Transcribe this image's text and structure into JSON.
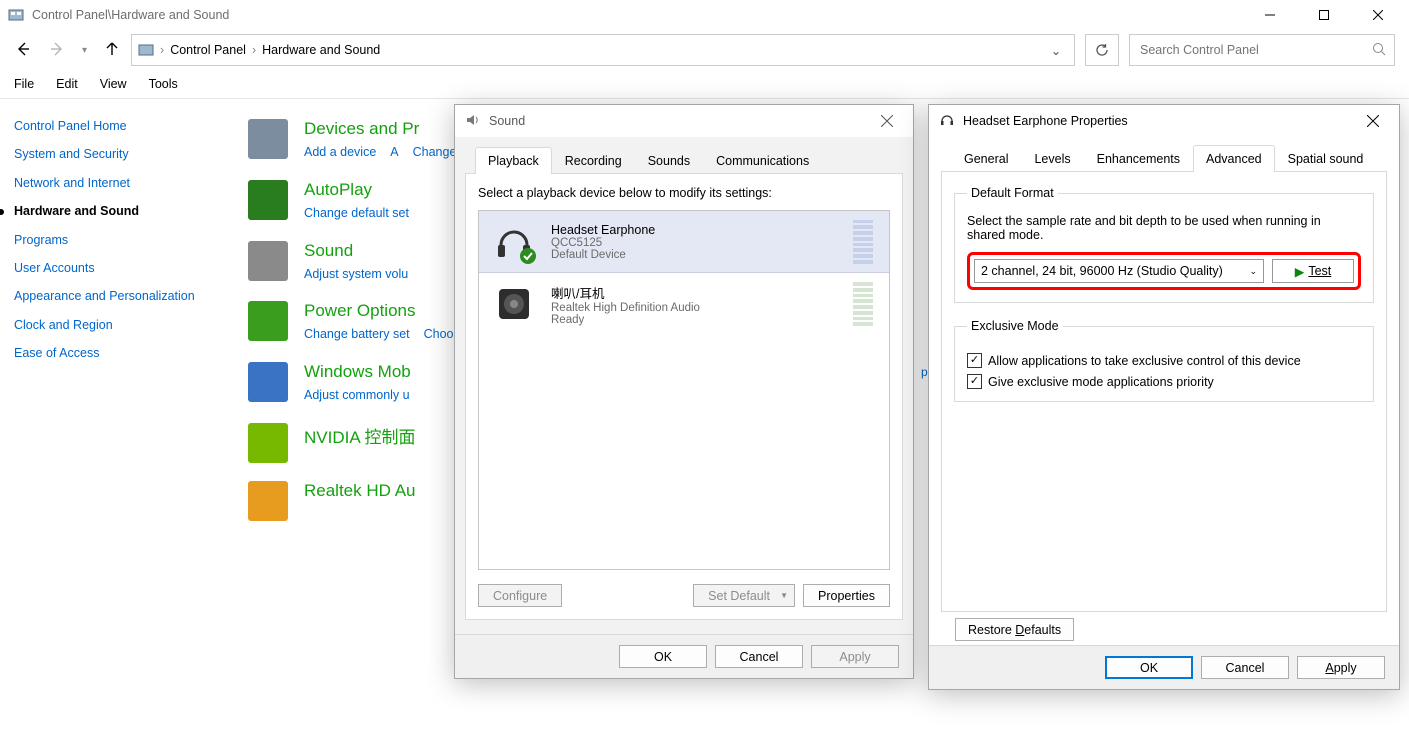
{
  "explorer": {
    "title": "Control Panel\\Hardware and Sound",
    "breadcrumb": [
      "Control Panel",
      "Hardware and Sound"
    ],
    "search_placeholder": "Search Control Panel",
    "menu": [
      "File",
      "Edit",
      "View",
      "Tools"
    ]
  },
  "sidebar": {
    "items": [
      {
        "label": "Control Panel Home"
      },
      {
        "label": "System and Security"
      },
      {
        "label": "Network and Internet"
      },
      {
        "label": "Hardware and Sound",
        "current": true
      },
      {
        "label": "Programs"
      },
      {
        "label": "User Accounts"
      },
      {
        "label": "Appearance and Personalization"
      },
      {
        "label": "Clock and Region"
      },
      {
        "label": "Ease of Access"
      }
    ]
  },
  "categories": [
    {
      "heading": "Devices and Pr",
      "links": [
        "Add a device",
        "A",
        "Change Windows T"
      ]
    },
    {
      "heading": "AutoPlay",
      "links": [
        "Change default set"
      ]
    },
    {
      "heading": "Sound",
      "links": [
        "Adjust system volu"
      ]
    },
    {
      "heading": "Power Options",
      "links": [
        "Change battery set",
        "Choose a power pl"
      ]
    },
    {
      "heading": "Windows Mob",
      "links": [
        "Adjust commonly u"
      ]
    },
    {
      "heading": "NVIDIA 控制面",
      "links": []
    },
    {
      "heading": "Realtek HD Au",
      "links": []
    }
  ],
  "stray_text": "pu",
  "sound_dialog": {
    "title": "Sound",
    "tabs": [
      "Playback",
      "Recording",
      "Sounds",
      "Communications"
    ],
    "active_tab": "Playback",
    "instruction": "Select a playback device below to modify its settings:",
    "devices": [
      {
        "name": "Headset Earphone",
        "sub1": "QCC5125",
        "sub2": "Default Device",
        "selected": true,
        "type": "headset"
      },
      {
        "name": "喇叭/耳机",
        "sub1": "Realtek High Definition Audio",
        "sub2": "Ready",
        "selected": false,
        "type": "speaker"
      }
    ],
    "configure": "Configure",
    "set_default": "Set Default",
    "properties": "Properties",
    "ok": "OK",
    "cancel": "Cancel",
    "apply": "Apply"
  },
  "props_dialog": {
    "title": "Headset Earphone Properties",
    "tabs": [
      "General",
      "Levels",
      "Enhancements",
      "Advanced",
      "Spatial sound"
    ],
    "active_tab": "Advanced",
    "default_format": {
      "legend": "Default Format",
      "desc": "Select the sample rate and bit depth to be used when running in shared mode.",
      "selected": "2 channel, 24 bit, 96000 Hz (Studio Quality)",
      "test": "Test"
    },
    "exclusive": {
      "legend": "Exclusive Mode",
      "opt1": "Allow applications to take exclusive control of this device",
      "opt2": "Give exclusive mode applications priority"
    },
    "restore": "Restore Defaults",
    "ok": "OK",
    "cancel": "Cancel",
    "apply": "Apply"
  }
}
